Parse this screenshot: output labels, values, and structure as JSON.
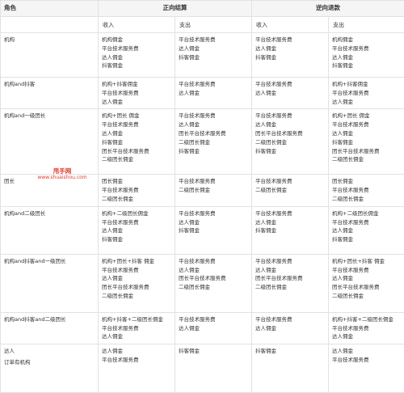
{
  "header": {
    "role": "角色",
    "forward": "正向结算",
    "reverse": "逆向退款",
    "sub": [
      "收入",
      "支出",
      "收入",
      "支出"
    ]
  },
  "watermark": {
    "line1": "甩手网",
    "line2": "www.shuaishou.com"
  },
  "rows": [
    {
      "role": [
        "机构"
      ],
      "cols": [
        [
          "机构佣金",
          "平台技术服务费",
          "达人佣金",
          "抖客佣金"
        ],
        [
          "平台技术服务费",
          "达人佣金",
          "抖客佣金"
        ],
        [
          "平台技术服务费",
          "达人佣金",
          "抖客佣金"
        ],
        [
          "机构佣金",
          "平台技术服务费",
          "达人佣金",
          "抖客佣金"
        ]
      ]
    },
    {
      "role": [
        "机构and抖客"
      ],
      "cols": [
        [
          "机构+抖客佣金",
          "平台技术服务费",
          "达人佣金"
        ],
        [
          "平台技术服务费",
          "达人佣金"
        ],
        [
          "平台技术服务费",
          "达人佣金"
        ],
        [
          "机构+抖客佣金",
          "平台技术服务费",
          "达人佣金"
        ]
      ]
    },
    {
      "role": [
        "机构and一级团长"
      ],
      "cols": [
        [
          "机构+团长 佣金",
          "平台技术服务费",
          "达人佣金",
          "抖客佣金",
          "团长平台技术服务费",
          "二级团长佣金"
        ],
        [
          "平台技术服务费",
          "达人佣金",
          "团长平台技术服务费",
          "二级团长佣金",
          "抖客佣金"
        ],
        [
          "平台技术服务费",
          "达人佣金",
          "团长平台技术服务费",
          "二级团长佣金",
          "抖客佣金"
        ],
        [
          "机构+团长 佣金",
          "平台技术服务费",
          "达人佣金",
          "抖客佣金",
          "团长平台技术服务费",
          "二级团长佣金"
        ]
      ]
    },
    {
      "role": [
        "团长"
      ],
      "cols": [
        [
          "团长佣金",
          "平台技术服务费",
          "二级团长佣金"
        ],
        [
          "平台技术服务费",
          "二级团长佣金"
        ],
        [
          "平台技术服务费",
          "二级团长佣金"
        ],
        [
          "团长佣金",
          "平台技术服务费",
          "二级团长佣金"
        ]
      ]
    },
    {
      "role": [
        "机构and二级团长"
      ],
      "cols": [
        [
          "机构+二级团长佣金",
          "平台技术服务费",
          "达人佣金",
          "抖客佣金"
        ],
        [
          "平台技术服务费",
          "达人佣金",
          "抖客佣金"
        ],
        [
          "平台技术服务费",
          "达人佣金",
          "抖客佣金"
        ],
        [
          "机构+二级团长佣金",
          "平台技术服务费",
          "达人佣金",
          "抖客佣金"
        ]
      ]
    },
    {
      "role": [
        "机构and抖客and一级团长"
      ],
      "cols": [
        [
          "机构+团长+抖客 佣金",
          "平台技术服务费",
          "达人佣金",
          "团长平台技术服务费",
          "二级团长佣金"
        ],
        [
          "平台技术服务费",
          "达人佣金",
          "团长平台技术服务费",
          "二级团长佣金"
        ],
        [
          "平台技术服务费",
          "达人佣金",
          "团长平台技术服务费",
          "二级团长佣金"
        ],
        [
          "机构+团长+抖客 佣金",
          "平台技术服务费",
          "达人佣金",
          "团长平台技术服务费",
          "二级团长佣金"
        ]
      ]
    },
    {
      "role": [
        "机构and抖客and二级团长"
      ],
      "cols": [
        [
          "机构+抖客+二级团长佣金",
          "平台技术服务费",
          "达人佣金"
        ],
        [
          "平台技术服务费",
          "达人佣金"
        ],
        [
          "平台技术服务费",
          "达人佣金"
        ],
        [
          "机构+抖客+二级团长佣金",
          "平台技术服务费",
          "达人佣金"
        ]
      ]
    },
    {
      "role": [
        "达人",
        "订单有机构"
      ],
      "cols": [
        [
          "达人佣金",
          "平台技术服务费"
        ],
        [
          "抖客佣金"
        ],
        [
          "抖客佣金"
        ],
        [
          "达人佣金",
          "平台技术服务费"
        ]
      ]
    }
  ]
}
